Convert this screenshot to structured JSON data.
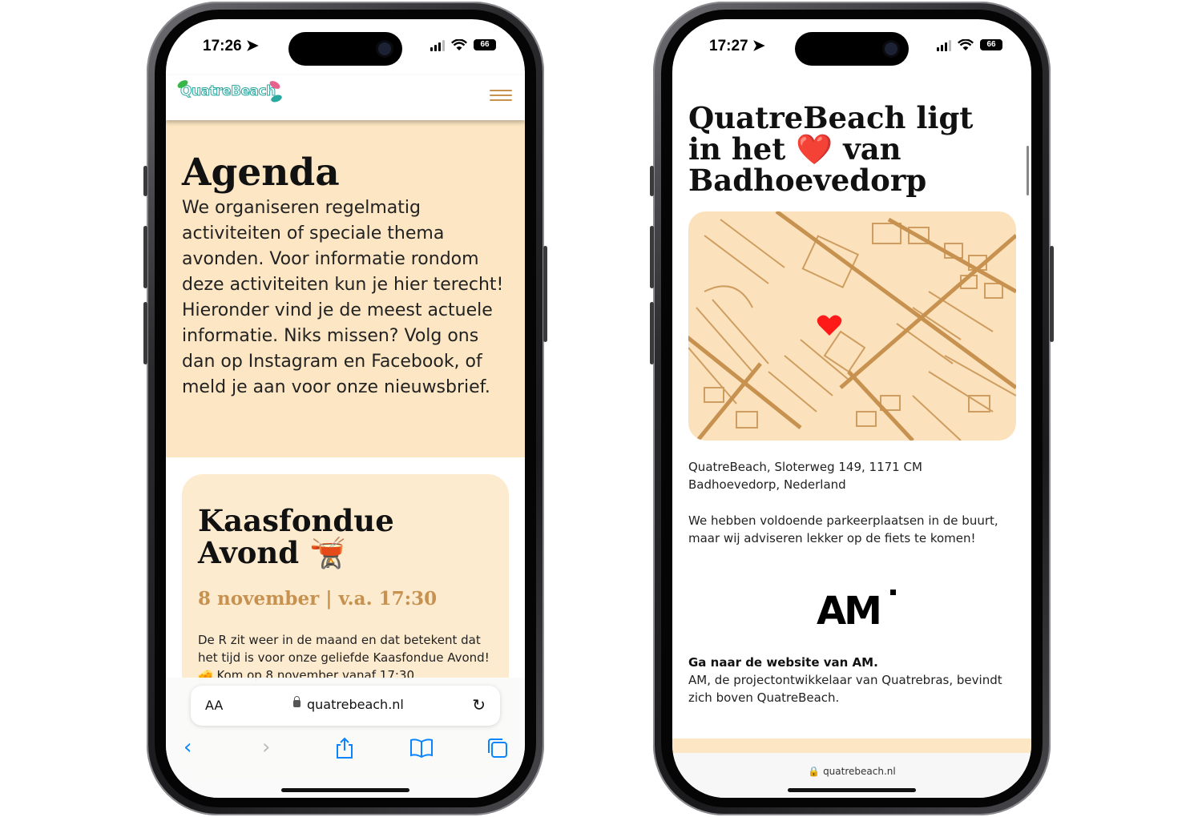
{
  "phone_left": {
    "status": {
      "time": "17:26",
      "battery": "66"
    },
    "header": {
      "logo": "QuatreBeach",
      "menu_icon": "hamburger-icon"
    },
    "intro": {
      "title": "Agenda",
      "text": "We organiseren regelmatig activiteiten of speciale thema avonden. Voor informatie rondom deze activiteiten kun je hier terecht! Hieronder vind je de meest actuele informatie. Niks missen? Volg ons dan op Instagram en Facebook, of meld je aan voor onze nieuwsbrief."
    },
    "event": {
      "title": "Kaasfondue Avond 🫕",
      "date": "8 november | v.a. 17:30",
      "text": "De R zit weer in de maand en dat betekent dat het tijd is voor onze geliefde Kaasfondue Avond! 🧀 Kom op 8 november vanaf 17:30"
    },
    "browser": {
      "aa": "AA",
      "url": "quatrebeach.nl"
    }
  },
  "phone_right": {
    "status": {
      "time": "17:27",
      "battery": "66"
    },
    "title": "QuatreBeach ligt in het ❤️ van Badhoevedorp",
    "address": "QuatreBeach, Sloterweg 149, 1171 CM Badhoevedorp, Nederland",
    "parking": "We hebben voldoende parkeerplaatsen in de buurt, maar wij adviseren lekker op de fiets te komen!",
    "partner": {
      "logo": "AM",
      "link": "Ga naar de website van AM.",
      "text": "AM, de projectontwikkelaar van Quatrebras, bevindt zich boven QuatreBeach."
    },
    "browser": {
      "url": "quatrebeach.nl"
    }
  },
  "colors": {
    "accent": "#c7914f",
    "cream": "#fde6c3",
    "card": "#fdebcf",
    "safari_blue": "#0a84ff",
    "heart": "#ff1a1a"
  }
}
